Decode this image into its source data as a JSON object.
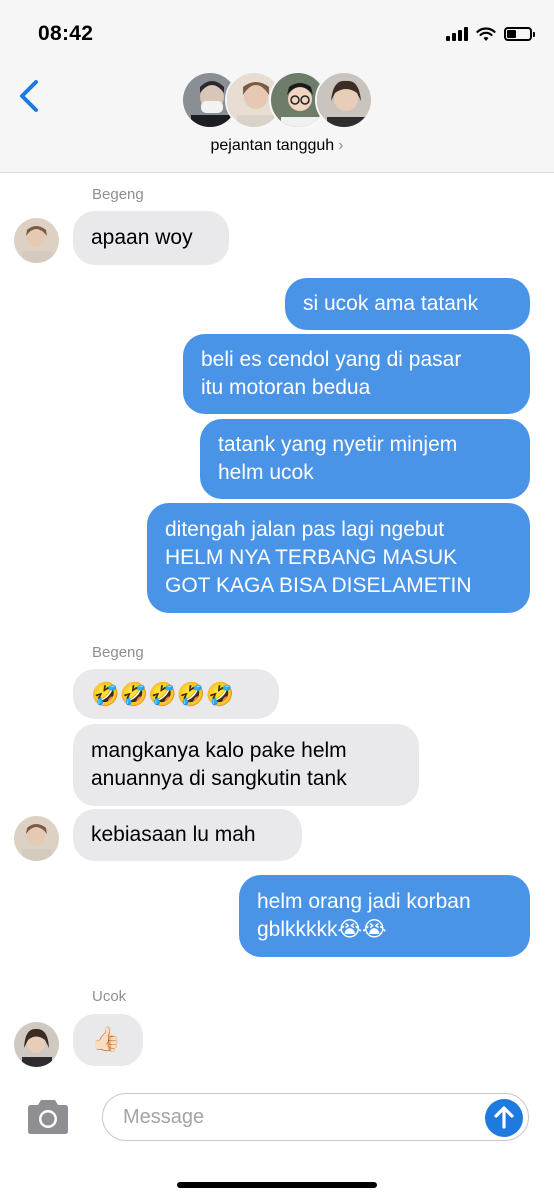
{
  "status_bar": {
    "time": "08:42"
  },
  "header": {
    "group_name": "pejantan tangguh",
    "chevron": "›"
  },
  "messages": [
    {
      "sender": "Begeng",
      "text": "apaan woy"
    },
    {
      "text_lines": [
        "si ucok ama tatank"
      ]
    },
    {
      "text_lines": [
        "beli es cendol yang di pasar",
        "itu motoran bedua"
      ]
    },
    {
      "text_lines": [
        "tatank yang nyetir minjem",
        "helm ucok"
      ]
    },
    {
      "text_lines": [
        "ditengah jalan pas lagi ngebut",
        "HELM NYA TERBANG MASUK",
        "GOT KAGA BISA DISELAMETIN"
      ]
    },
    {
      "sender": "Begeng",
      "text": "🤣🤣🤣🤣🤣"
    },
    {
      "text_lines": [
        "mangkanya kalo pake helm",
        "anuannya di sangkutin tank"
      ]
    },
    {
      "text": "kebiasaan lu mah"
    },
    {
      "text_lines": [
        "helm orang jadi korban",
        "gblkkkkk😭😭"
      ]
    },
    {
      "sender": "Ucok",
      "text": "👍🏻"
    }
  ],
  "composer": {
    "placeholder": "Message"
  }
}
